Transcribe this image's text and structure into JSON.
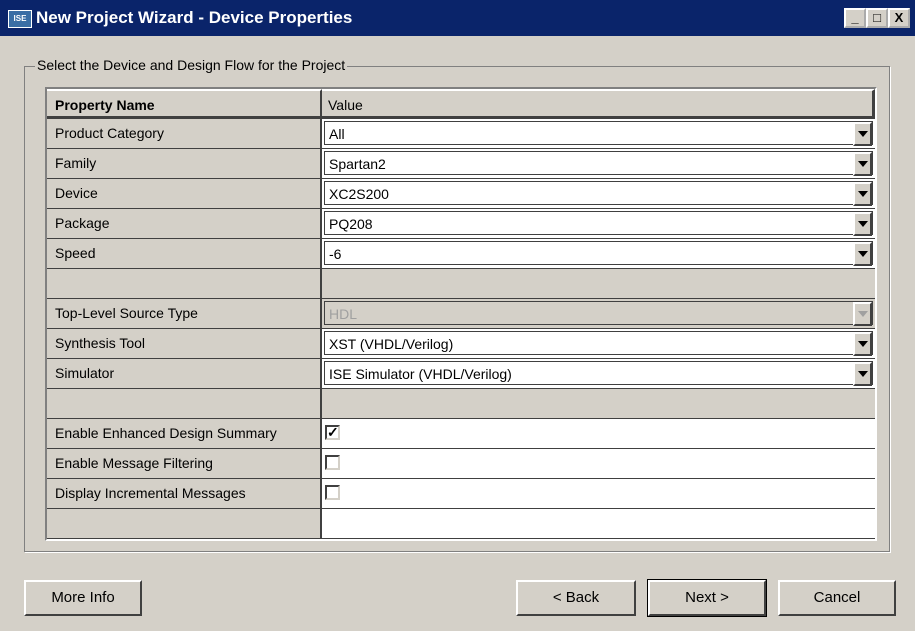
{
  "window": {
    "title": "New Project Wizard - Device Properties",
    "app_icon_text": "ISE",
    "min_label": "_",
    "max_label": "□",
    "close_label": "X"
  },
  "group": {
    "legend": "Select the Device and Design Flow for the Project"
  },
  "grid": {
    "header": {
      "name": "Property Name",
      "value": "Value"
    },
    "rows": [
      {
        "name": "Product Category",
        "value": "All"
      },
      {
        "name": "Family",
        "value": "Spartan2"
      },
      {
        "name": "Device",
        "value": "XC2S200"
      },
      {
        "name": "Package",
        "value": "PQ208"
      },
      {
        "name": "Speed",
        "value": "-6"
      },
      {
        "name": "Top-Level Source Type",
        "value": "HDL"
      },
      {
        "name": "Synthesis Tool",
        "value": "XST (VHDL/Verilog)"
      },
      {
        "name": "Simulator",
        "value": "ISE Simulator (VHDL/Verilog)"
      },
      {
        "name": "Enable Enhanced Design Summary",
        "checked": true
      },
      {
        "name": "Enable Message Filtering",
        "checked": false
      },
      {
        "name": "Display Incremental Messages",
        "checked": false
      }
    ]
  },
  "buttons": {
    "more_info": "More Info",
    "back": "< Back",
    "next": "Next >",
    "cancel": "Cancel"
  },
  "colors": {
    "titlebar": "#0a246a",
    "face": "#d4d0c8"
  }
}
